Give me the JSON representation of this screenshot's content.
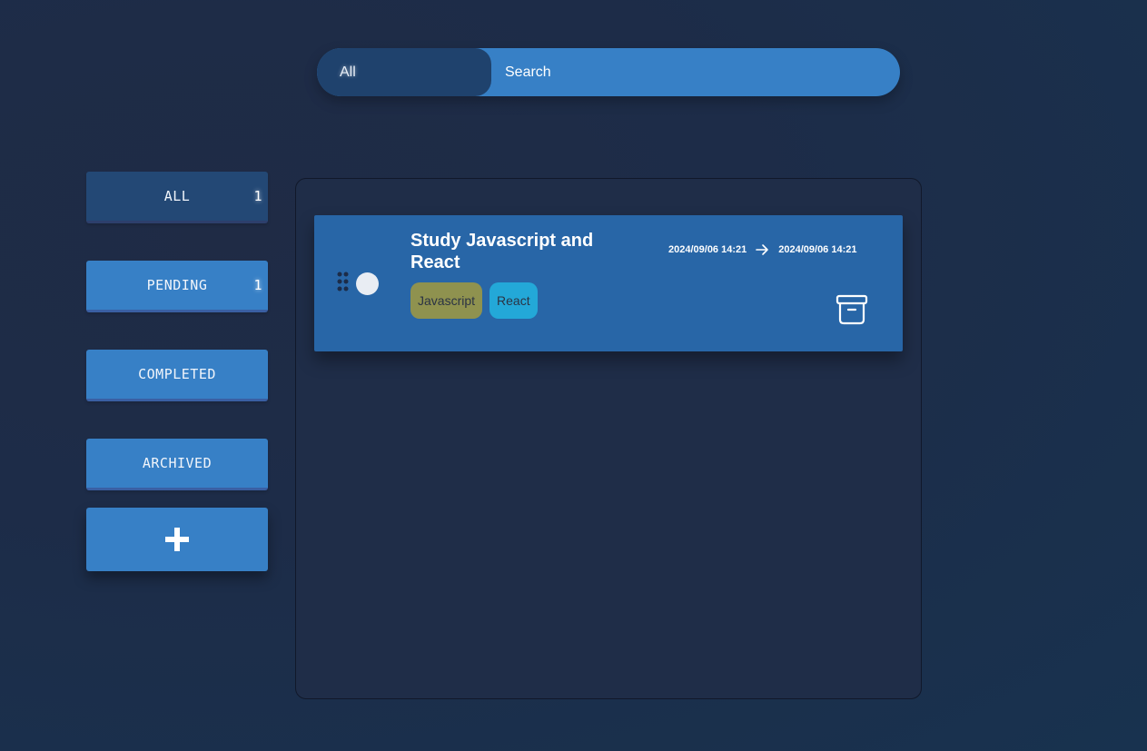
{
  "search": {
    "filter_value": "All",
    "placeholder": "Search"
  },
  "sidebar": {
    "items": [
      {
        "label": "ALL",
        "count": "1"
      },
      {
        "label": "PENDING",
        "count": "1"
      },
      {
        "label": "COMPLETED"
      },
      {
        "label": "ARCHIVED"
      }
    ],
    "add_icon": "plus-icon"
  },
  "tasks": [
    {
      "title": "Study Javascript and React",
      "tags": [
        {
          "label": "Javascript",
          "color": "#8f924f"
        },
        {
          "label": "React",
          "color": "#23a8d8"
        }
      ],
      "start": "2024/09/06 14:21",
      "end": "2024/09/06 14:21",
      "icons": [
        "drag-handle-icon",
        "status-circle",
        "arrow-right-icon",
        "archive-icon"
      ]
    }
  ],
  "colors": {
    "accent": "#3780c6",
    "active": "#234875",
    "card": "#2866a7"
  }
}
